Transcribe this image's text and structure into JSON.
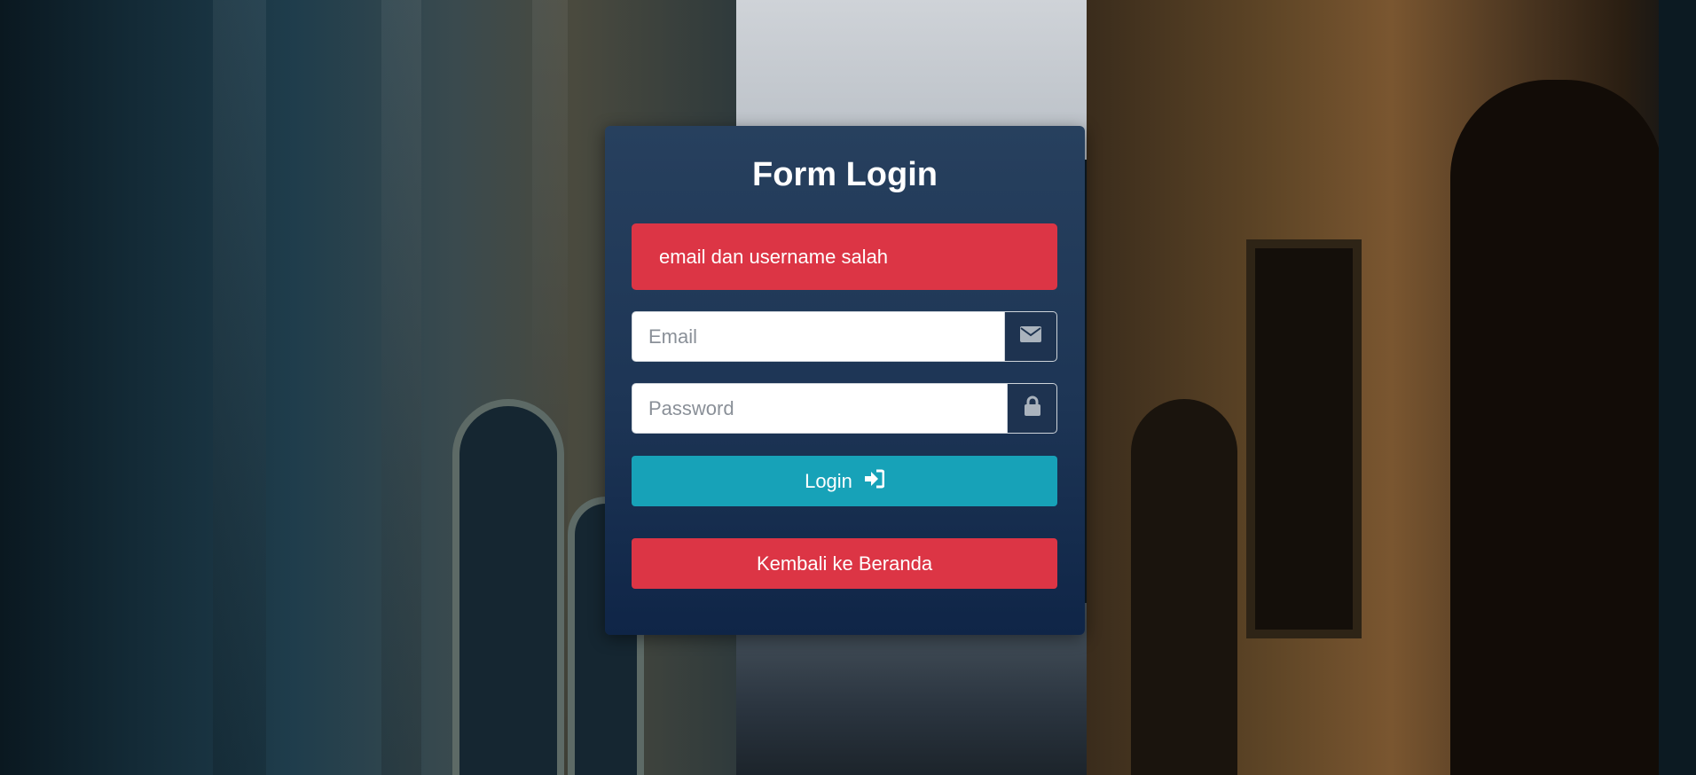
{
  "form": {
    "title": "Form Login",
    "alert_message": "email dan username salah",
    "email": {
      "placeholder": "Email",
      "value": "",
      "icon": "envelope-icon"
    },
    "password": {
      "placeholder": "Password",
      "value": "",
      "icon": "lock-icon"
    },
    "login_button": {
      "label": "Login",
      "icon": "sign-in-icon"
    },
    "back_button": {
      "label": "Kembali ke Beranda"
    }
  },
  "colors": {
    "card_top": "#27405e",
    "card_bottom": "#0f2547",
    "alert": "#dc3545",
    "login_button": "#17a2b8",
    "back_button": "#dc3545",
    "addon": "#1e3350"
  }
}
